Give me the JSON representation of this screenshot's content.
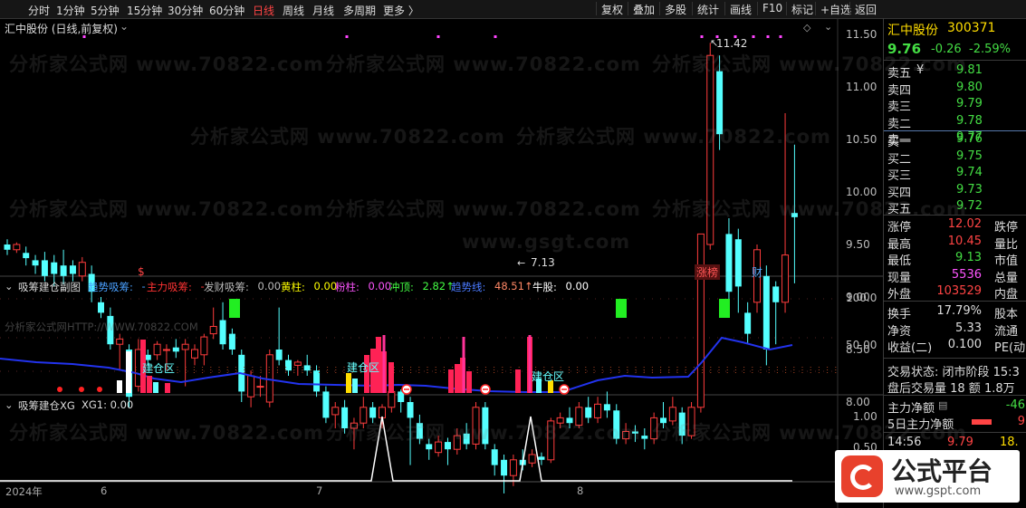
{
  "toolbar": {
    "periods": [
      "分时",
      "1分钟",
      "5分钟",
      "15分钟",
      "30分钟",
      "60分钟",
      "日线",
      "周线",
      "月线",
      "多周期",
      "更多 〉"
    ],
    "active_period": "日线",
    "right_buttons": [
      "复权",
      "叠加",
      "多股",
      "统计",
      "画线",
      "F10",
      "标记",
      "+自选",
      "返回"
    ]
  },
  "main_chart": {
    "title": "汇中股份 (日线,前复权)",
    "high_label": "11.42",
    "low_label": "7.13",
    "tag_zhangbang": "涨榜",
    "tag_cai": "财",
    "tag_dollar": "$",
    "y_ticks": [
      "11.50",
      "11.00",
      "10.50",
      "10.00",
      "9.50",
      "9.00",
      "8.50",
      "8.00",
      "7.50"
    ]
  },
  "sub_chart1": {
    "name": "吸筹建仓副图",
    "items": [
      {
        "label": "趋势吸筹:",
        "value": "-",
        "color": "#4aa0ff"
      },
      {
        "label": "主力吸筹:",
        "value": "-",
        "color": "#ff3333"
      },
      {
        "label": "发财吸筹:",
        "value": "0.00",
        "color": "#bbbbbb"
      },
      {
        "label": "黄柱:",
        "value": "0.00",
        "color": "#ffff00"
      },
      {
        "label": "粉柱:",
        "value": "0.00",
        "color": "#ff55ff"
      },
      {
        "label": "冲顶:",
        "value": "2.82↑",
        "color": "#44ff44"
      },
      {
        "label": "趋势线:",
        "value": "48.51↑",
        "color": "#4a7aff"
      },
      {
        "label": "牛股:",
        "value": "0.00",
        "color": "#ffffff"
      }
    ],
    "zone_label": "建仓区",
    "watermark": "分析家公式网HTTP://WWW.70822.COM",
    "y_ticks": [
      "100.0",
      "50.00"
    ]
  },
  "sub_chart2": {
    "name": "吸筹建仓XG",
    "xg_label": "XG1: 0.00",
    "y_ticks": [
      "1.00",
      "0.50"
    ]
  },
  "date_axis": [
    "2024年",
    "6",
    "7",
    "8"
  ],
  "watermarks": [
    "分析家公式网 www.70822.com",
    "www.gsgt.com"
  ],
  "quote": {
    "name": "汇中股份",
    "code": "300371",
    "price": "9.76",
    "change": "-0.26",
    "pct": "-2.59%",
    "sells": [
      {
        "label": "卖五",
        "mark": "¥",
        "price": "9.81"
      },
      {
        "label": "卖四",
        "mark": "",
        "price": "9.80"
      },
      {
        "label": "卖三",
        "mark": "",
        "price": "9.79"
      },
      {
        "label": "卖二",
        "mark": "",
        "price": "9.78"
      },
      {
        "label": "卖一",
        "mark": "",
        "price": "9.77"
      }
    ],
    "buys": [
      {
        "label": "买一",
        "price": "9.76"
      },
      {
        "label": "买二",
        "price": "9.75"
      },
      {
        "label": "买三",
        "price": "9.74"
      },
      {
        "label": "买四",
        "price": "9.73"
      },
      {
        "label": "买五",
        "price": "9.72"
      }
    ],
    "stats": [
      {
        "label": "涨停",
        "value": "12.02",
        "color": "#ff4444",
        "label2": "跌停"
      },
      {
        "label": "最高",
        "value": "10.45",
        "color": "#ff4444",
        "label2": "量比"
      },
      {
        "label": "最低",
        "value": "9.13",
        "color": "#44dd44",
        "label2": "市值"
      },
      {
        "label": "现量",
        "value": "5536",
        "color": "#ff55ff",
        "label2": "总量"
      },
      {
        "label": "外盘",
        "value": "103529",
        "color": "#ff4444",
        "label2": "内盘"
      }
    ],
    "stats2": [
      {
        "label": "换手",
        "value": "17.79%",
        "label2": "股本"
      },
      {
        "label": "净资",
        "value": "5.33",
        "label2": "流通"
      },
      {
        "label": "收益(二)",
        "value": "0.100",
        "label2": "PE(动"
      }
    ],
    "status_line": "交易状态: 闭市阶段 15:3",
    "after_hours": "盘后交易量 18 额 1.8万",
    "main_net": "主力净额",
    "main_net_val": "-46",
    "main_net5": "5日主力净额",
    "main_net5_val": "9",
    "tick": {
      "time": "14:56",
      "price": "9.79",
      "vol": "18."
    }
  },
  "logo": {
    "text": "公式平台",
    "url": "www.gspt.com"
  },
  "colors": {
    "up": "#ff3c3c",
    "down": "#54ffff",
    "green": "#44dd44",
    "blue": "#2233ee"
  }
}
